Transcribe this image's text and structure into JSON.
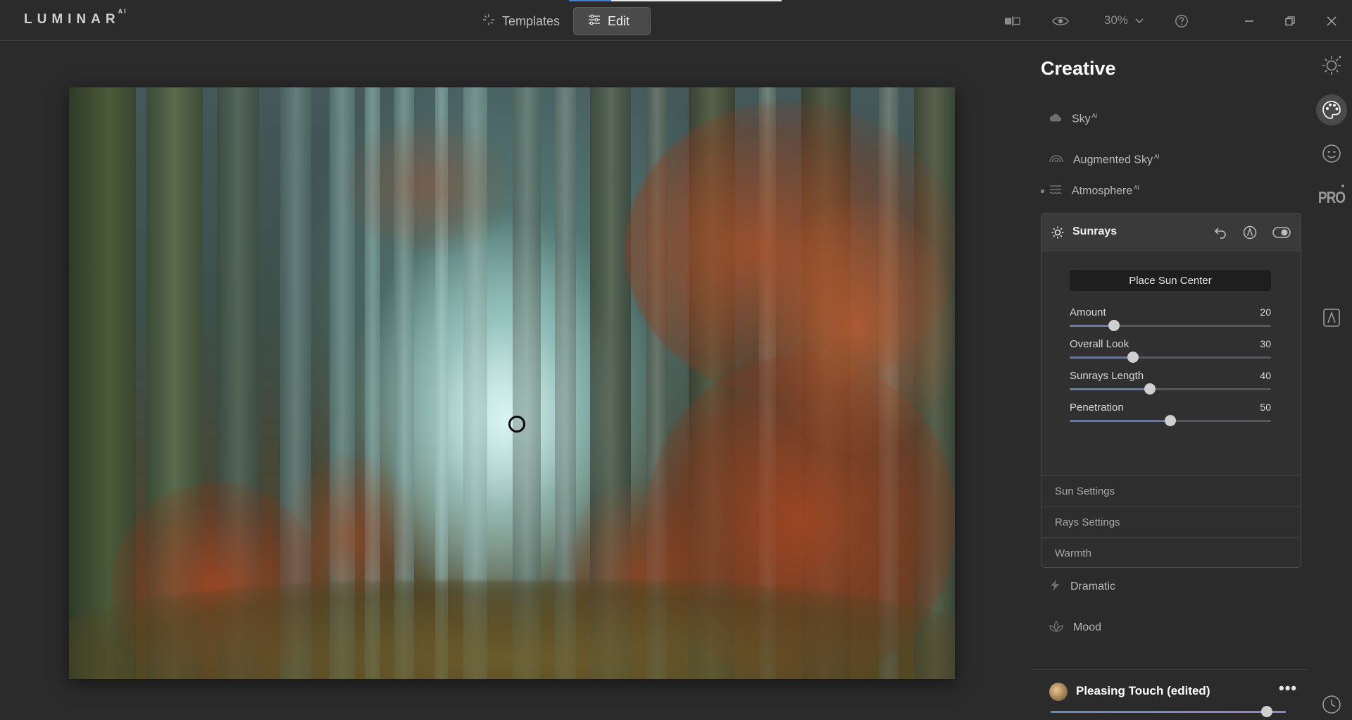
{
  "app": {
    "logo": "LUMINAR",
    "logo_sup": "AI"
  },
  "topbar": {
    "tabs": [
      {
        "label": "Templates",
        "icon": "sparkle-icon",
        "active": false
      },
      {
        "label": "Edit",
        "icon": "sliders-icon",
        "active": true
      }
    ],
    "zoom_label": "30%",
    "icons": [
      "compare-icon",
      "eye-icon",
      "help-icon",
      "minimize-icon",
      "restore-icon",
      "close-icon"
    ]
  },
  "panel": {
    "title": "Creative",
    "tools": [
      {
        "label": "Sky",
        "sup": "AI",
        "icon": "cloud-icon"
      },
      {
        "label": "Augmented Sky",
        "sup": "AI",
        "icon": "rainbow-icon"
      },
      {
        "label": "Atmosphere",
        "sup": "AI",
        "icon": "waves-icon"
      }
    ],
    "sunrays": {
      "label": "Sunrays",
      "place_button": "Place Sun Center",
      "sliders": [
        {
          "label": "Amount",
          "value": "20",
          "fraction": 0.22
        },
        {
          "label": "Overall Look",
          "value": "30",
          "fraction": 0.315
        },
        {
          "label": "Sunrays Length",
          "value": "40",
          "fraction": 0.4
        },
        {
          "label": "Penetration",
          "value": "50",
          "fraction": 0.5
        }
      ],
      "sections": [
        "Sun Settings",
        "Rays Settings",
        "Warmth"
      ]
    },
    "more_tools": [
      {
        "label": "Dramatic",
        "icon": "bolt-icon"
      },
      {
        "label": "Mood",
        "icon": "flower-icon"
      }
    ]
  },
  "preset": {
    "name": "Pleasing Touch (edited)",
    "more": "•••",
    "fraction": 0.92
  },
  "rail": [
    "sun-icon",
    "palette-icon",
    "face-icon",
    "pro-icon",
    "mask-icon",
    "history-icon"
  ],
  "rail_pro_label": "PRO"
}
